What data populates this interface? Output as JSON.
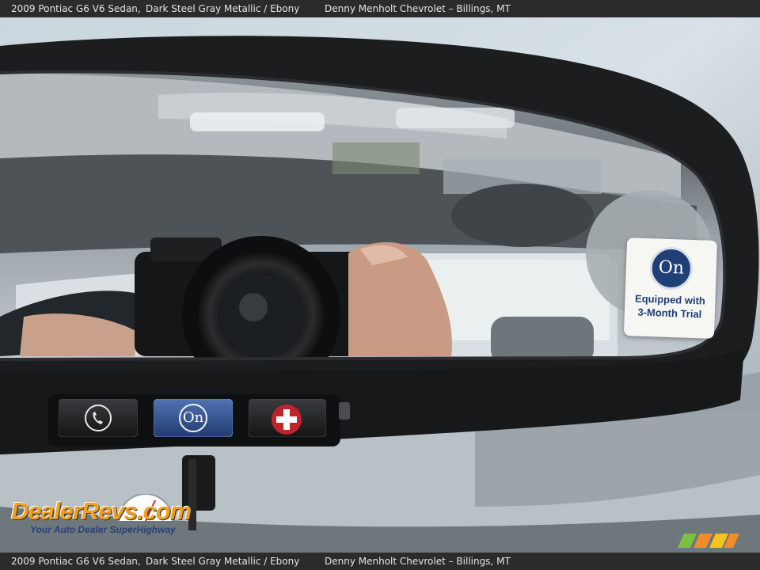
{
  "caption": {
    "vehicle": "2009 Pontiac G6 V6 Sedan,",
    "color": "Dark Steel Gray Metallic / Ebony",
    "dealer": "Denny Menholt Chevrolet – Billings, MT"
  },
  "sticker": {
    "logo_text": "On",
    "line1": "Equipped with",
    "line2": "3-Month Trial"
  },
  "buttons": {
    "phone_icon": "phone-icon",
    "onstar_label": "On",
    "emergency_icon": "red-cross-icon"
  },
  "watermark": {
    "brand": "DealerRevs.com",
    "tagline": "Your Auto Dealer SuperHighway"
  },
  "colors": {
    "mirror_frame": "#1c1d1f",
    "onstar_blue": "#2f4f8f",
    "emergency_red": "#c0232b",
    "watermark_orange": "#f0a020"
  }
}
